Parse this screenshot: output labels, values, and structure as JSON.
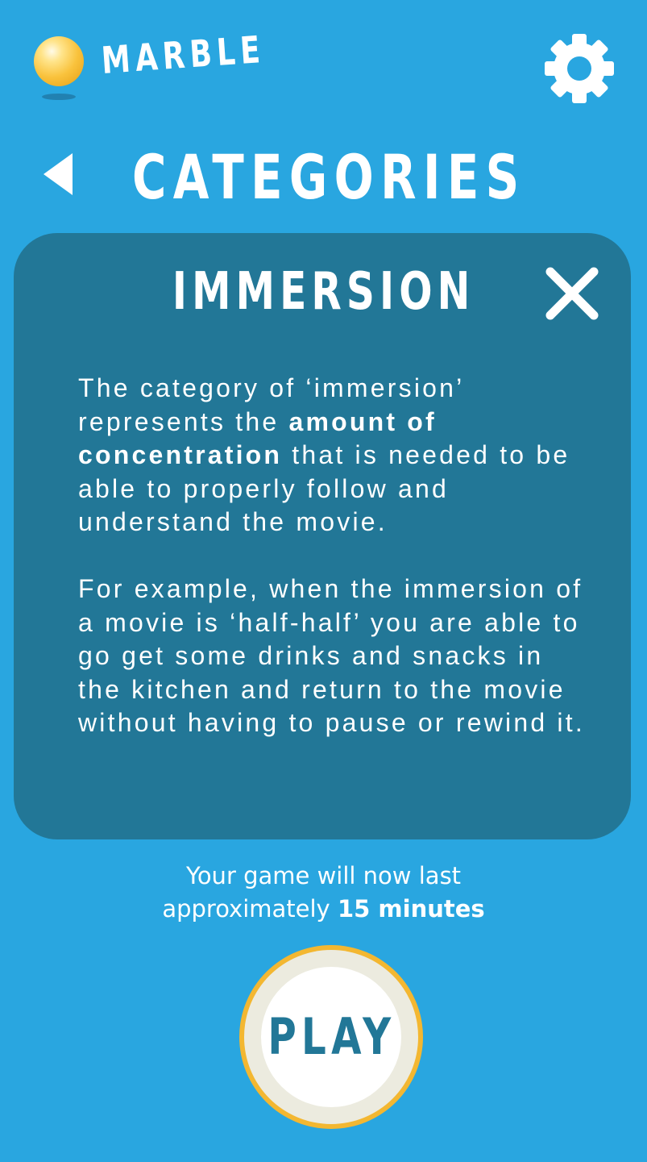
{
  "app": {
    "logo_text": "MARBLE"
  },
  "header": {
    "settings_icon": "gear-icon"
  },
  "page": {
    "back_icon": "back-arrow-icon",
    "title": "CATEGORIES"
  },
  "info_card": {
    "title": "IMMERSION",
    "close_icon": "close-icon",
    "paragraph1": {
      "before": "The category of ‘immersion’ represents the ",
      "bold": "amount of concentration",
      "after": " that is needed to be able to properly follow and understand the movie."
    },
    "paragraph2": "For example, when the immersion of a movie is ‘half-half’ you are able to go get some drinks and snacks in the kitchen and return to the movie without having to pause or rewind it."
  },
  "duration": {
    "line1": "Your game will now last",
    "line2_prefix": "approximately ",
    "line2_bold": "15 minutes"
  },
  "play_button": {
    "label": "PLAY"
  },
  "colors": {
    "background": "#29a6e0",
    "card": "#227797",
    "play_ring": "#f3b731",
    "play_text": "#227797"
  }
}
